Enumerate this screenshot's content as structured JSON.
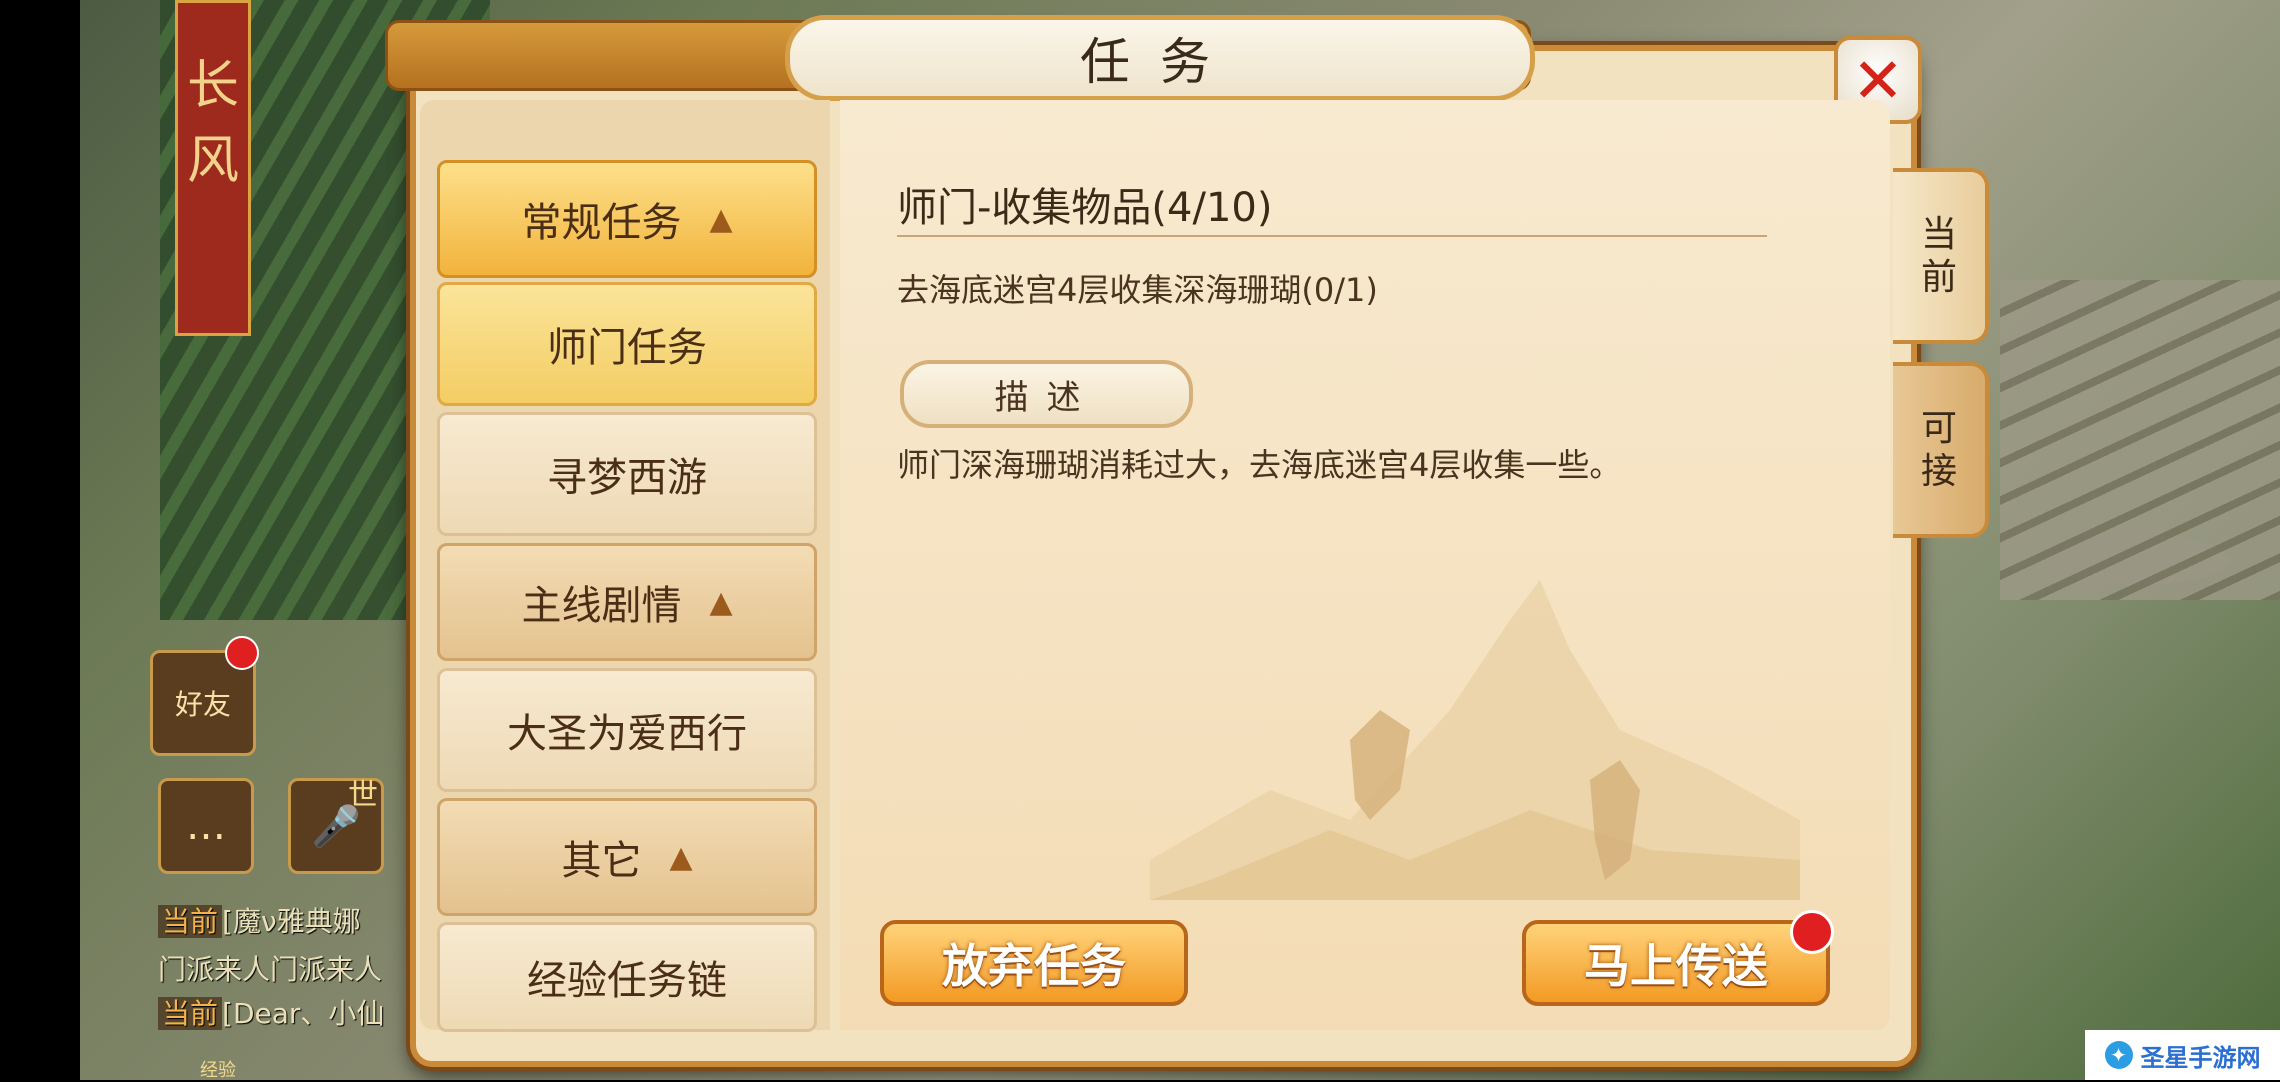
{
  "background": {
    "pillar_text": "长风",
    "friends_label": "好友",
    "world_label": "世",
    "chat": [
      {
        "tag": "当前",
        "text": "[魔ν雅典娜"
      },
      {
        "tag": "",
        "text": "门派来人门派来人"
      },
      {
        "tag": "当前",
        "text": "[Dear、小仙"
      }
    ],
    "exp_label": "经验"
  },
  "dialog": {
    "title": "任务",
    "close_icon": "close-icon"
  },
  "categories": [
    {
      "label": "常规任务",
      "subs": [
        "师门任务",
        "寻梦西游"
      ]
    },
    {
      "label": "主线剧情",
      "subs": [
        "大圣为爱西行"
      ]
    },
    {
      "label": "其它",
      "subs": [
        "经验任务链"
      ]
    }
  ],
  "detail": {
    "title": "师门-收集物品(4/10)",
    "goal": "去海底迷宫4层收集深海珊瑚(0/1)",
    "desc_label": "描述",
    "desc_text": "师门深海珊瑚消耗过大，去海底迷宫4层收集一些。"
  },
  "actions": {
    "abandon": "放弃任务",
    "teleport": "马上传送"
  },
  "tabs": {
    "current": [
      "当",
      "前"
    ],
    "available": [
      "可",
      "接"
    ]
  },
  "watermark": "圣星手游网",
  "colors": {
    "accent": "#f2b33c",
    "button": "#f39a24",
    "notify": "#e02020"
  }
}
